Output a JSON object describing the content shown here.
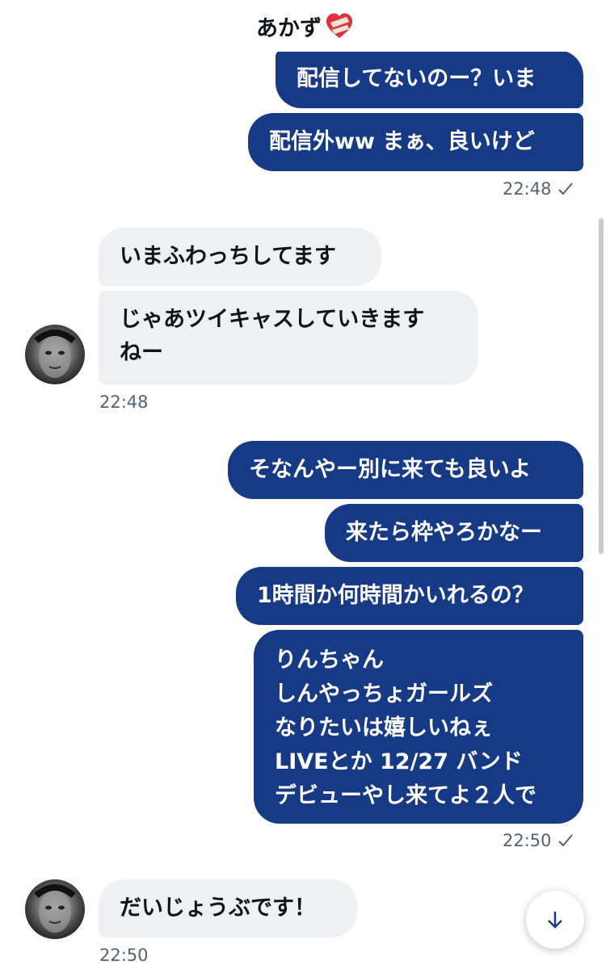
{
  "header": {
    "title": "あかず",
    "heart_icon": "mending-heart-icon"
  },
  "messages": {
    "s1": "配信してないのー？いま",
    "s2": "配信外ww まぁ、良いけど",
    "t1": "22:48",
    "r1": "いまふわっちしてます",
    "r2_line1": "じゃあツイキャスしていきます",
    "r2_line2": "ねー",
    "t2": "22:48",
    "s3": "そなんやー別に来ても良いよ",
    "s4": "来たら枠やろかなー",
    "s5": "1時間か何時間かいれるの？",
    "s6_lines": [
      "りんちゃん",
      "しんやっちょガールズ",
      "なりたいは嬉しいねぇ",
      "LIVEとか 12/27 バンド",
      "デビューやし来てよ２人で"
    ],
    "t3": "22:50",
    "r3": "だいじょうぶです！",
    "t4": "22:50"
  },
  "colors": {
    "sent_bubble": "#173a86",
    "received_bubble": "#eef1f4",
    "timestamp": "#536471"
  },
  "icons": {
    "read_check": "check-icon",
    "scroll_down": "arrow-down-icon"
  }
}
